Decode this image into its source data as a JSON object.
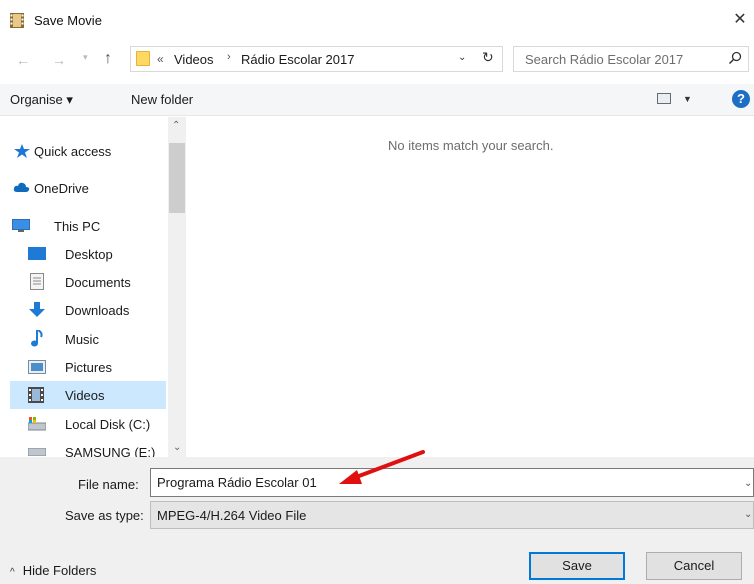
{
  "window": {
    "title": "Save Movie"
  },
  "address_bar": {
    "overflow": "«",
    "crumbs": [
      "Videos",
      "Rádio Escolar 2017"
    ],
    "separator": "›"
  },
  "search": {
    "placeholder": "Search Rádio Escolar 2017"
  },
  "toolbar": {
    "organise_label": "Organise ▾",
    "new_folder_label": "New folder",
    "help_label": "?"
  },
  "nav_pane": {
    "items": [
      {
        "label": "Quick access",
        "icon": "star-icon"
      },
      {
        "label": "OneDrive",
        "icon": "cloud-icon"
      },
      {
        "label": "This PC",
        "icon": "computer-icon"
      },
      {
        "label": "Desktop",
        "icon": "desktop-icon"
      },
      {
        "label": "Documents",
        "icon": "documents-icon"
      },
      {
        "label": "Downloads",
        "icon": "download-icon"
      },
      {
        "label": "Music",
        "icon": "music-icon"
      },
      {
        "label": "Pictures",
        "icon": "pictures-icon"
      },
      {
        "label": "Videos",
        "icon": "videos-icon",
        "selected": true
      },
      {
        "label": "Local Disk (C:)",
        "icon": "disk-icon"
      },
      {
        "label": "SAMSUNG (E:)",
        "icon": "drive-icon"
      }
    ]
  },
  "content": {
    "empty_message": "No items match your search."
  },
  "form": {
    "file_name_label": "File name:",
    "file_name_value": "Programa Rádio Escolar 01",
    "save_type_label": "Save as type:",
    "save_type_value": "MPEG-4/H.264 Video File"
  },
  "footer": {
    "hide_folders_label": "Hide Folders",
    "save_label": "Save",
    "cancel_label": "Cancel"
  },
  "colors": {
    "accent": "#0078d7",
    "selection": "#cce8ff",
    "annotation_arrow": "#e01010"
  }
}
